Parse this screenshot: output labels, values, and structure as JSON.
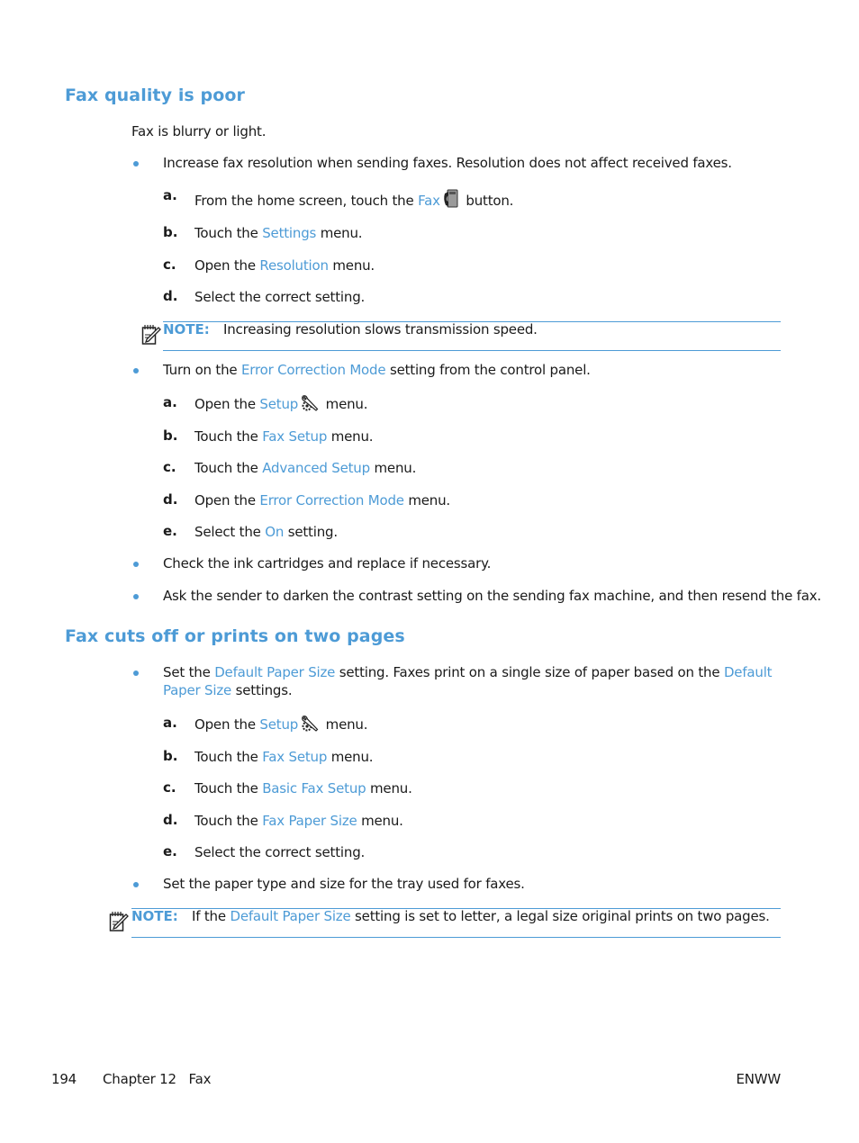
{
  "sections": [
    {
      "title": "Fax quality is poor",
      "intro": "Fax is blurry or light.",
      "bullets": [
        {
          "text": "Increase fax resolution when sending faxes. Resolution does not affect received faxes.",
          "steps": [
            {
              "label": "a.",
              "pre": "From the home screen, touch the ",
              "link": "Fax",
              "icon": "fax-icon",
              "post": " button."
            },
            {
              "label": "b.",
              "pre": "Touch the ",
              "link": "Settings",
              "post": " menu."
            },
            {
              "label": "c.",
              "pre": "Open the ",
              "link": "Resolution",
              "post": " menu."
            },
            {
              "label": "d.",
              "pre": "Select the correct setting.",
              "link": "",
              "post": ""
            }
          ],
          "note": {
            "label": "NOTE:",
            "text": "Increasing resolution slows transmission speed."
          }
        },
        {
          "pre": "Turn on the ",
          "link": "Error Correction Mode",
          "post": " setting from the control panel.",
          "steps": [
            {
              "label": "a.",
              "pre": "Open the ",
              "link": "Setup",
              "icon": "setup-wrench-gear-icon",
              "post": " menu."
            },
            {
              "label": "b.",
              "pre": "Touch the ",
              "link": "Fax Setup",
              "post": " menu."
            },
            {
              "label": "c.",
              "pre": "Touch the ",
              "link": "Advanced Setup",
              "post": " menu."
            },
            {
              "label": "d.",
              "pre": "Open the ",
              "link": "Error Correction Mode",
              "post": " menu."
            },
            {
              "label": "e.",
              "pre": "Select the ",
              "link": "On",
              "post": " setting."
            }
          ]
        },
        {
          "text": "Check the ink cartridges and replace if necessary."
        },
        {
          "text": "Ask the sender to darken the contrast setting on the sending fax machine, and then resend the fax."
        }
      ]
    },
    {
      "title": "Fax cuts off or prints on two pages",
      "bullets": [
        {
          "pre": "Set the ",
          "link": "Default Paper Size",
          "mid": " setting. Faxes print on a single size of paper based on the ",
          "link2a": "Default",
          "link2b": "Paper Size",
          "post": " settings.",
          "steps": [
            {
              "label": "a.",
              "pre": "Open the ",
              "link": "Setup",
              "icon": "setup-wrench-gear-icon",
              "post": " menu."
            },
            {
              "label": "b.",
              "pre": "Touch the ",
              "link": "Fax Setup",
              "post": " menu."
            },
            {
              "label": "c.",
              "pre": "Touch the ",
              "link": "Basic Fax Setup",
              "post": " menu."
            },
            {
              "label": "d.",
              "pre": "Touch the ",
              "link": "Fax Paper Size",
              "post": " menu."
            },
            {
              "label": "e.",
              "pre": "Select the correct setting.",
              "link": "",
              "post": ""
            }
          ]
        },
        {
          "text": "Set the paper type and size for the tray used for faxes."
        }
      ],
      "note": {
        "label": "NOTE:",
        "pre": "If the ",
        "link": "Default Paper Size",
        "post": " setting is set to letter, a legal size original prints on two pages."
      }
    }
  ],
  "footer": {
    "page_number": "194",
    "chapter": "Chapter 12   Fax",
    "right": "ENWW"
  },
  "colors": {
    "accent": "#4d9bd6",
    "text": "#1a1a1a"
  }
}
